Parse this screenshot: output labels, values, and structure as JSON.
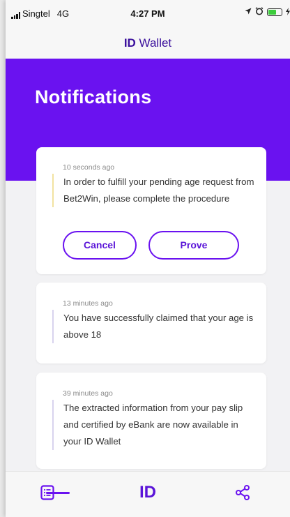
{
  "status_bar": {
    "carrier": "Singtel",
    "network": "4G",
    "time": "4:27 PM",
    "battery_level": 0.6
  },
  "app": {
    "title_bold": "ID",
    "title_rest": " Wallet"
  },
  "header": {
    "title": "Notifications"
  },
  "notifications": [
    {
      "time": "10 seconds ago",
      "message": "In order to fulfill your pending age request from Bet2Win, please complete the procedure",
      "status_color": "#f2e2a0",
      "actions": {
        "cancel": "Cancel",
        "prove": "Prove"
      }
    },
    {
      "time": "13 minutes ago",
      "message": "You have successfully claimed that your age is above 18",
      "status_color": "#d8d3ee"
    },
    {
      "time": "39 minutes ago",
      "message": "The extracted information from your pay slip and certified by eBank are now available in your ID Wallet",
      "status_color": "#d8d3ee"
    }
  ],
  "bottom_nav": {
    "items": [
      {
        "icon": "list-icon",
        "active": true
      },
      {
        "label": "ID",
        "active": false
      },
      {
        "icon": "share-icon",
        "active": false
      }
    ]
  },
  "colors": {
    "accent": "#6a12f0",
    "title_text": "#3a0f9c"
  }
}
